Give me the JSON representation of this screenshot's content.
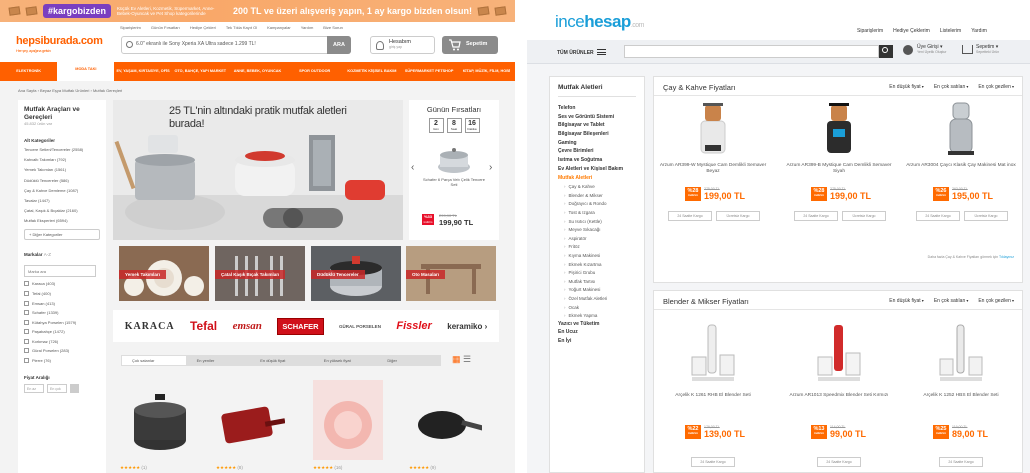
{
  "hepsiburada": {
    "promo": {
      "badge": "#kargobizden",
      "badge_sub": "hepsiden",
      "small_text": "Küçük Ev Aletleri, Kozmetik, Süpermarket, Anne-Bebek-Oyuncak ve Pet Shop kategorilerinde",
      "main_text": "200 TL ve üzeri alışveriş yapın, 1 ay kargo bizden olsun!"
    },
    "top_links": [
      "Siparişlerim",
      "Günün Fırsatları",
      "Hediye Çekleri",
      "Tek Tıkla Kayıt Ol",
      "Kampanyalar",
      "Yardım",
      "Bize Sorun"
    ],
    "logo": "hepsiburada.com",
    "logo_tagline": "Her şey, ayağına gelsin",
    "search": {
      "value": "6.0\" ekranlı ile Sony Xperia XA Ultra sadece 1.299 TL!",
      "button": "ARA"
    },
    "account": {
      "label": "Hesabım",
      "sub": "giriş yap"
    },
    "cart": "Sepetim",
    "nav": [
      "ELEKTRONİK",
      "MODA TAKI",
      "EV, YAŞAM, KIRTASİYE, OFİS",
      "OTO, BAHÇE, YAPI MARKET",
      "ANNE, BEBEK, OYUNCAK",
      "SPOR OUTDOOR",
      "KOZMETİK KİŞİSEL BAKIM",
      "SÜPERMARKET PETSHOP",
      "KİTAP, MÜZİK, FİLM, HOBİ"
    ],
    "breadcrumb": [
      "Ana Sayfa",
      "Beyaz Eşya Mutfak Ürünleri",
      "Mutfak Gereçleri"
    ],
    "sidebar": {
      "title": "Mutfak Araçları ve Gereçleri",
      "count": "45.832 ürün var",
      "sub_heading": "Alt Kategoriler",
      "categories": [
        "Tencere Setleri/Tencereler (2558)",
        "Kahvaltı Takımları (792)",
        "Yemek Takımları (1561)",
        "Düdüklü Tencereler (586)",
        "Çay & Kahve Demleme (1087)",
        "Tavalar (1447)",
        "Çatal, Kaşık & Bıçaklar (2160)",
        "Mutfak Eksperleri (6594)"
      ],
      "more_label": "+ Diğer Kategoriler",
      "brands_heading": "Markalar",
      "brands_count": "A-Z",
      "brand_search_placeholder": "Marka ara",
      "brands": [
        "Karaca (403)",
        "Tefal (400)",
        "Emsan (413)",
        "Schafer (1339)",
        "Kütahya Porselen (1579)",
        "Paşabahçe (1472)",
        "Korkmaz (726)",
        "Güral Porselen (283)",
        "Pierre (76)"
      ],
      "price_heading": "Fiyat Aralığı",
      "price_min": "En az",
      "price_max": "En çok"
    },
    "hero": {
      "title": "25 TL'nin altındaki pratik mutfak aletleri burada!"
    },
    "deal": {
      "title": "Günün Fırsatları",
      "timer": [
        {
          "value": "2",
          "unit": "Gün"
        },
        {
          "value": "8",
          "unit": "Saat"
        },
        {
          "value": "16",
          "unit": "Dakika"
        }
      ],
      "product": "Schafer 6 Parça Veb Çelik Tencere Seti",
      "discount": "%33",
      "discount_sub": "indirim",
      "old_price": "299,90 TL",
      "price": "199,90 TL"
    },
    "tiles": [
      "Yemek Takımları",
      "Çatal Kaşık Bıçak Takımları",
      "Düdüklü Tencereler",
      "Oto Masaları"
    ],
    "brands": [
      "KARACA",
      "Tefal",
      "emsan",
      "SCHAFER",
      "GÜRAL PORSELEN",
      "Fissler",
      "keramiko"
    ],
    "sort": [
      "Çok satanlar",
      "En yeniler",
      "En düşük fiyat",
      "En yüksek fiyat",
      "Diğer"
    ],
    "reviews": [
      "(1)",
      "(8)",
      "(16)",
      "(9)"
    ]
  },
  "incehesap": {
    "logo_a": "ince",
    "logo_b": "hesap",
    "logo_c": ".com",
    "top_links": [
      "Siparişlerim",
      "Hediye Çeklerim",
      "Listelerim",
      "Yardım"
    ],
    "all_products": "TÜM ÜRÜNLER",
    "login": {
      "label": "Üye Girişi",
      "sub": "Yeni Üyelik Oluştur"
    },
    "cart": {
      "label": "Sepetim",
      "sub": "Sepetteki Ürün"
    },
    "sidebar": {
      "title": "Mutfak Aletleri",
      "top_cats": [
        "Telefon",
        "Ses ve Görüntü Sistemi",
        "Bilgisayar ve Tablet",
        "Bilgisayar Bileşenleri",
        "Gaming",
        "Çevre Birimleri",
        "Isıtma ve Soğutma",
        "Ev Aletleri ve Kişisel Bakım"
      ],
      "active": "Mutfak Aletleri",
      "sub_cats": [
        "Çay & Kahve",
        "Blender & Mikser",
        "Doğrayıcı & Rondo",
        "Tost & Izgara",
        "Su Isıtıcı (Kettle)",
        "Meyve Sıkacağı",
        "Aspiratör",
        "Fritöz",
        "Kıyma Makinesi",
        "Ekmek Kızartma",
        "Pişirici Grubu",
        "Mutfak Tartısı",
        "Yoğurt Makinesi",
        "Özel Mutfak Aletleri",
        "Ocak",
        "Ekmek Yapma"
      ],
      "bottom_cats": [
        "Yazıcı ve Tüketim",
        "En Ucuz",
        "En İyi"
      ]
    },
    "sections": [
      {
        "title": "Çay & Kahve Fiyatları",
        "sorts": [
          "En düşük fiyat",
          "En çok satılan",
          "En çok gezilen"
        ],
        "products": [
          {
            "name": "Arzum AR399-W Mystique Cam Demlikli Semaver Beyaz",
            "discount": "%28",
            "old": "275,00 TL",
            "price": "199,00 TL"
          },
          {
            "name": "Arzum AR399-B Mystique Cam Demlikli Semaver Siyah",
            "discount": "%28",
            "old": "275,00 TL",
            "price": "199,00 TL"
          },
          {
            "name": "Arzum AR3004 Çaycı Klasik Çay Makinesi Mat inox",
            "discount": "%26",
            "old": "263,00 TL",
            "price": "195,00 TL"
          }
        ],
        "buttons": [
          "24 Saatte Kargo",
          "Ücretsiz Kargo"
        ],
        "footer": "Daha fazla Çay & Kahve Fiyatları görmek için",
        "footer_link": "Tıklayınız"
      },
      {
        "title": "Blender & Mikser Fiyatları",
        "sorts": [
          "En düşük fiyat",
          "En çok satılan",
          "En çok gezilen"
        ],
        "products": [
          {
            "name": "Arçelik K 1261 RHB El Blender Seti",
            "discount": "%22",
            "old": "179,00 TL",
            "price": "139,00 TL"
          },
          {
            "name": "Arzum AR1013 Speedmix Blender Seti Kırmızı",
            "discount": "%13",
            "old": "114,00 TL",
            "price": "99,00 TL"
          },
          {
            "name": "Arçelik K 1252 HBS El Blender Seti",
            "discount": "%25",
            "old": "119,00 TL",
            "price": "89,00 TL"
          }
        ],
        "buttons": [
          "24 Saatte Kargo"
        ]
      }
    ]
  },
  "colors": {
    "hb_orange": "#ff6000",
    "ih_blue": "#1a9ed8",
    "ih_orange": "#ff6a00"
  }
}
